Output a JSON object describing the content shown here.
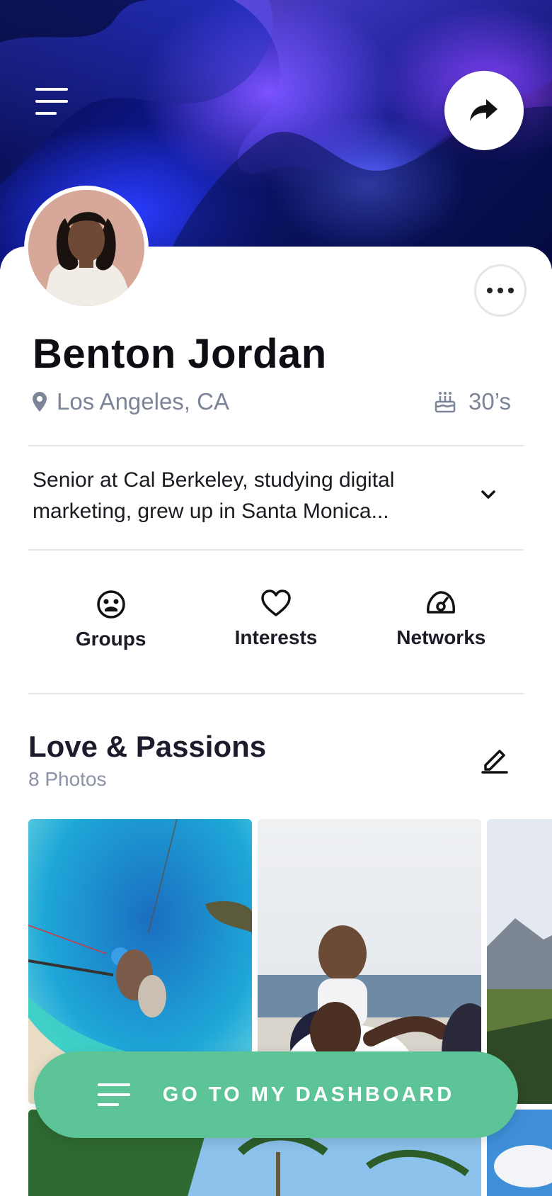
{
  "profile": {
    "name": "Benton Jordan",
    "location": "Los Angeles, CA",
    "age": "30’s",
    "bio": "Senior at Cal Berkeley, studying digital marketing, grew up in Santa Monica..."
  },
  "tabs": [
    {
      "label": "Groups",
      "icon": "smile-face-icon"
    },
    {
      "label": "Interests",
      "icon": "heart-icon"
    },
    {
      "label": "Networks",
      "icon": "speedometer-icon"
    }
  ],
  "section": {
    "title": "Love & Passions",
    "subtitle": "8 Photos"
  },
  "cta": {
    "label": "GO TO MY DASHBOARD"
  },
  "colors": {
    "accent": "#5cc497",
    "header_dark": "#0d1890",
    "text_muted": "#7c8597"
  }
}
